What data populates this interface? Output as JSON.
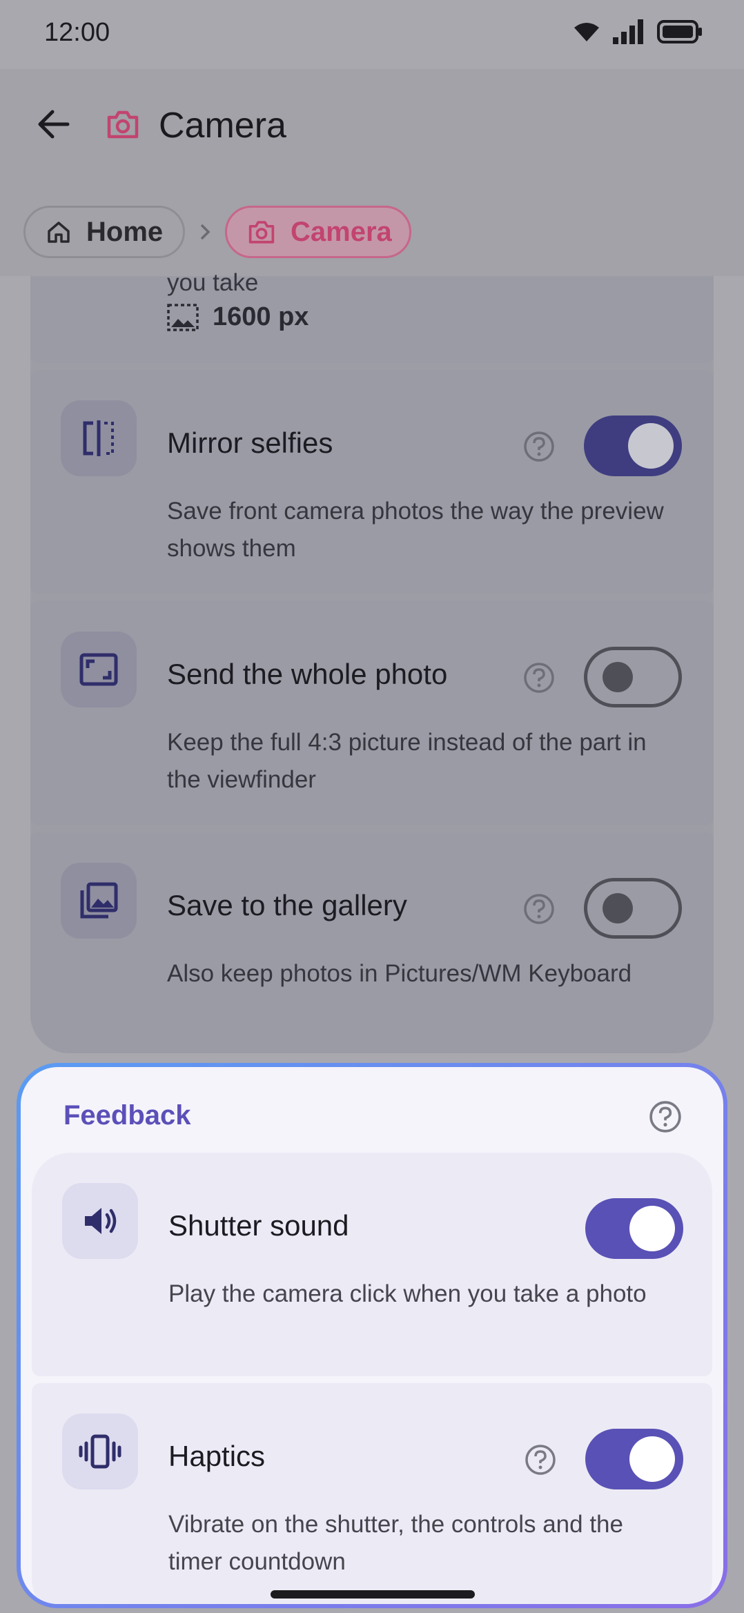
{
  "status_bar": {
    "time": "12:00"
  },
  "header": {
    "title": "Camera"
  },
  "breadcrumb": [
    {
      "label": "Home"
    },
    {
      "label": "Camera"
    }
  ],
  "partial_row": {
    "text": "you take",
    "value": "1600 px"
  },
  "camera_rows": [
    {
      "label": "Mirror selfies",
      "description": "Save front camera photos the way the preview shows them",
      "enabled": true
    },
    {
      "label": "Send the whole photo",
      "description": "Keep the full 4:3 picture instead of the part in the viewfinder",
      "enabled": false
    },
    {
      "label": "Save to the gallery",
      "description": "Also keep photos in Pictures/WM Keyboard",
      "enabled": false
    }
  ],
  "feedback": {
    "title": "Feedback",
    "rows": [
      {
        "label": "Shutter sound",
        "description": "Play the camera click when you take a photo",
        "enabled": true
      },
      {
        "label": "Haptics",
        "description": "Vibrate on the shutter, the controls and the timer countdown",
        "enabled": true
      }
    ]
  },
  "colors": {
    "accent": "#5951b5",
    "camera_pink": "#c2446f",
    "section_title": "#5b50b8"
  },
  "icons": [
    "wifi-icon",
    "signal-icon",
    "battery-icon",
    "back-arrow-icon",
    "camera-icon",
    "home-icon",
    "chevron-right-icon",
    "image-size-icon",
    "mirror-icon",
    "crop-icon",
    "gallery-icon",
    "help-icon",
    "speaker-icon",
    "vibrate-icon"
  ]
}
